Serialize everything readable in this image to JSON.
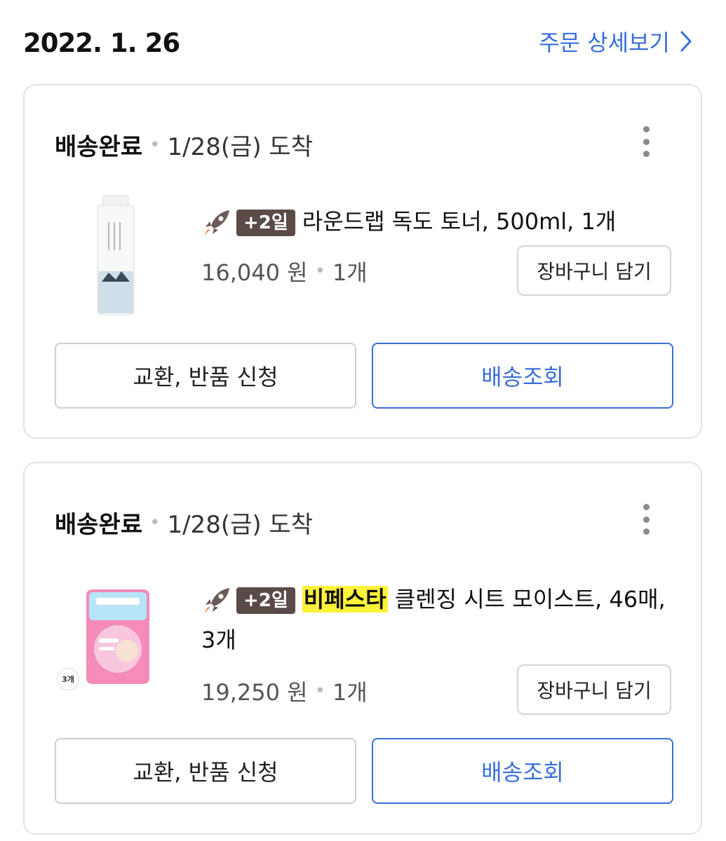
{
  "header": {
    "order_date": "2022. 1. 26",
    "detail_link": "주문 상세보기"
  },
  "orders": [
    {
      "status": "배송완료",
      "arrival": "1/28(금) 도착",
      "badge": "+2일",
      "brand": "",
      "title": "라운드랩 독도 토너, 500ml, 1개",
      "price": "16,040 원",
      "quantity": "1개",
      "cart_label": "장바구니 담기",
      "exchange_label": "교환, 반품 신청",
      "track_label": "배송조회"
    },
    {
      "status": "배송완료",
      "arrival": "1/28(금) 도착",
      "badge": "+2일",
      "brand": "비페스타",
      "title": " 클렌징 시트 모이스트, 46매, 3개",
      "price": "19,250 원",
      "quantity": "1개",
      "image_tag": "3개",
      "cart_label": "장바구니 담기",
      "exchange_label": "교환, 반품 신청",
      "track_label": "배송조회"
    }
  ],
  "colors": {
    "accent": "#3a6fd8",
    "badge_bg": "#5a4a48",
    "brand_highlight": "#fff23a",
    "card_border": "#e3e3e3"
  }
}
